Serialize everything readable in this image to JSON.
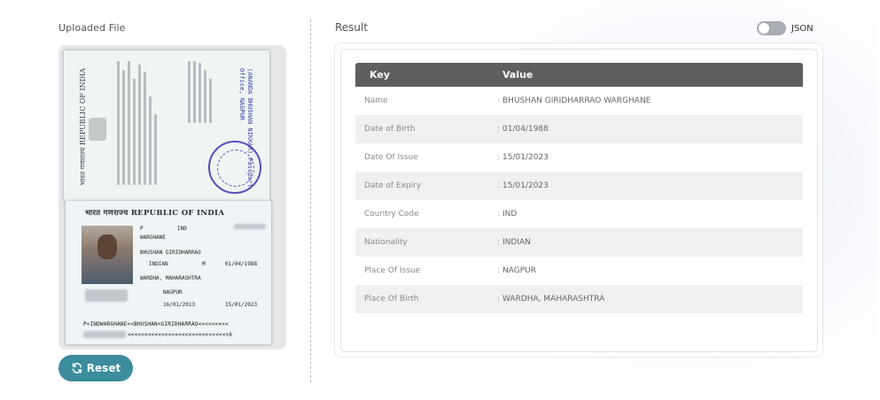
{
  "left_panel": {
    "title": "Uploaded File",
    "reset_label": "Reset",
    "passport_image": {
      "header": "भारत गणराज्य REPUBLIC OF INDIA",
      "top_vertical_text": "भारत गणराज्य REPUBLIC OF INDIA",
      "blue_stamp_text": "(ANANDA BHUSHAN NIKKAR) Passport Office, NAGPUR",
      "type": "P",
      "country_code": "IND",
      "surname": "WARGHANE",
      "given_names": "BHUSHAN GIRIDHARRAO",
      "nationality": "INDIAN",
      "sex": "M",
      "dob": "01/04/1988",
      "place_of_birth": "WARDHA, MAHARASHTRA",
      "place_of_issue": "NAGPUR",
      "date_of_issue": "16/01/2013",
      "date_of_expiry": "15/01/2023",
      "mrz_line1": "P<INDWARGHANE<<BHUSHAN<GIRIDHARRAO<<<<<<<<<",
      "mrz_line2": "<<<<<<<<<<<<<<<<<<<<<<<<<<<<<<6"
    }
  },
  "right_panel": {
    "title": "Result",
    "json_toggle_label": "JSON",
    "json_toggle_on": false,
    "table": {
      "headers": {
        "key": "Key",
        "value": "Value"
      },
      "separator": ":",
      "rows": [
        {
          "key": "Name",
          "value": "BHUSHAN GIRIDHARRAO WARGHANE"
        },
        {
          "key": "Date of Birth",
          "value": "01/04/1988"
        },
        {
          "key": "Date Of Issue",
          "value": "15/01/2023"
        },
        {
          "key": "Date of Expiry",
          "value": "15/01/2023"
        },
        {
          "key": "Country Code",
          "value": "IND"
        },
        {
          "key": "Nationality",
          "value": "INDIAN"
        },
        {
          "key": "Place Of Issue",
          "value": "NAGPUR"
        },
        {
          "key": "Place Of Birth",
          "value": "WARDHA, MAHARASHTRA"
        }
      ]
    }
  },
  "colors": {
    "reset_button": "#3b8c9c",
    "table_header": "#5f5f5f",
    "alt_row": "#f0f0f0",
    "toggle_off": "#a9acb4"
  }
}
